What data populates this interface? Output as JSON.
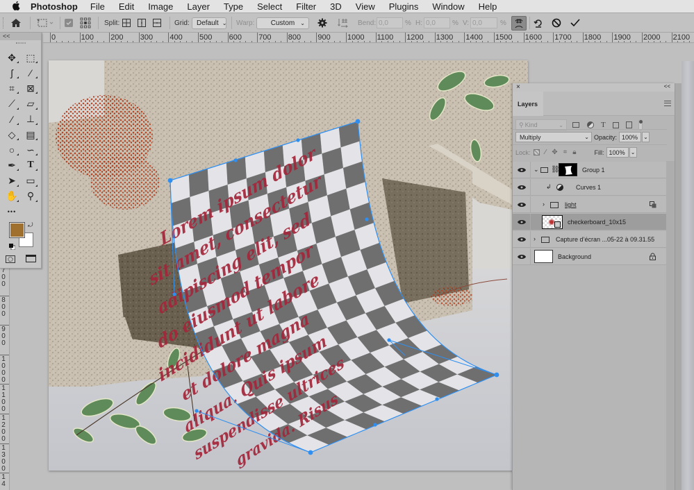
{
  "menubar": {
    "apple_icon": "apple-logo-icon",
    "items": [
      "Photoshop",
      "File",
      "Edit",
      "Image",
      "Layer",
      "Type",
      "Select",
      "Filter",
      "3D",
      "View",
      "Plugins",
      "Window",
      "Help"
    ]
  },
  "options_bar": {
    "home_icon": "home-icon",
    "transform_icon": "transform-marquee-icon",
    "checkbox_icon": "checkbox-icon",
    "reference_point_icon": "reference-point-grid-icon",
    "split_label": "Split:",
    "split_icons": [
      "split-cross-icon",
      "split-vertical-icon",
      "split-horizontal-icon"
    ],
    "grid_label": "Grid:",
    "grid_value": "Default",
    "warp_label": "Warp:",
    "warp_value": "Custom",
    "gear_icon": "gear-icon",
    "orientation_icon": "warp-orientation-icon",
    "bend_label": "Bend:",
    "bend_value": "0,0",
    "h_label": "H:",
    "h_value": "0,0",
    "v_label": "V:",
    "v_value": "0,0",
    "percent": "%",
    "warp_mode_icon": "warp-mode-icon",
    "undo_icon": "undo-icon",
    "cancel_icon": "cancel-icon",
    "commit_icon": "commit-checkmark-icon"
  },
  "rulers": {
    "horizontal": [
      "0",
      "100",
      "200",
      "300",
      "400",
      "500",
      "600",
      "700",
      "800",
      "900",
      "1000",
      "1100",
      "1200",
      "1300",
      "1400",
      "1500",
      "1600",
      "1700",
      "1800",
      "1900",
      "2000",
      "2100"
    ],
    "vertical": [
      "700",
      "800",
      "900",
      "1000",
      "1100",
      "1200",
      "1300",
      "14"
    ]
  },
  "tools": {
    "collapse": "<<",
    "items": [
      {
        "name": "move-tool",
        "glyph": "✥"
      },
      {
        "name": "rectangular-marquee-tool",
        "glyph": "⬚"
      },
      {
        "name": "lasso-tool",
        "glyph": "ʃ"
      },
      {
        "name": "magic-wand-tool",
        "glyph": "⁄"
      },
      {
        "name": "crop-tool",
        "glyph": "⌗"
      },
      {
        "name": "frame-tool",
        "glyph": "⊠"
      },
      {
        "name": "eyedropper-tool",
        "glyph": "⟋"
      },
      {
        "name": "healing-brush-tool",
        "glyph": "▱"
      },
      {
        "name": "brush-tool",
        "glyph": "∕"
      },
      {
        "name": "clone-stamp-tool",
        "glyph": "⊥"
      },
      {
        "name": "eraser-tool",
        "glyph": "◇"
      },
      {
        "name": "gradient-tool",
        "glyph": "▤"
      },
      {
        "name": "blur-tool",
        "glyph": "○"
      },
      {
        "name": "dodge-tool",
        "glyph": "∽"
      },
      {
        "name": "pen-tool",
        "glyph": "✒"
      },
      {
        "name": "type-tool",
        "glyph": "T"
      },
      {
        "name": "path-selection-tool",
        "glyph": "➤"
      },
      {
        "name": "rectangle-tool",
        "glyph": "▭"
      },
      {
        "name": "hand-tool",
        "glyph": "✋"
      },
      {
        "name": "zoom-tool",
        "glyph": "⚲"
      },
      {
        "name": "edit-toolbar",
        "glyph": "•••"
      }
    ],
    "foreground_color": "#a0712e",
    "background_color": "#ffffff",
    "swap_icon": "swap-colors-icon",
    "default_colors_icon": "default-colors-icon",
    "quick_mask_icon": "quick-mask-icon",
    "screen_mode_icon": "screen-mode-icon"
  },
  "canvas": {
    "warp_color": "#2f8ff0",
    "text_color": "#a3263a",
    "checker_dark": "#6f6f70",
    "checker_light": "#e4e4e8",
    "lorem_lines": [
      "Lorem ipsum dolor",
      "sit amet, consectetur",
      "adipiscing elit, sed",
      "do eiusmod tempor",
      "incididunt ut labore",
      "et dolore magna",
      "aliqua. Quis ipsum",
      "suspendisse ultrices",
      "gravida. Risus"
    ]
  },
  "layers_panel": {
    "close": "×",
    "collapse": "<<",
    "tab_label": "Layers",
    "menu_icon": "panel-menu-icon",
    "filter_placeholder": "Kind",
    "filter_icons": [
      "pixel-filter-icon",
      "adjustment-filter-icon",
      "type-filter-icon",
      "shape-filter-icon",
      "smart-object-filter-icon"
    ],
    "blend_mode": "Multiply",
    "opacity_label": "Opacity:",
    "opacity_value": "100%",
    "lock_label": "Lock:",
    "lock_icons": [
      "lock-transparent-icon",
      "lock-image-icon",
      "lock-position-icon",
      "lock-artboard-icon",
      "lock-all-icon"
    ],
    "fill_label": "Fill:",
    "fill_value": "100%",
    "layers": [
      {
        "name": "Group 1",
        "type": "group",
        "expanded": true,
        "selected": false
      },
      {
        "name": "Curves 1",
        "type": "adjustment",
        "selected": false
      },
      {
        "name": "light",
        "type": "group",
        "expanded": false,
        "selected": false
      },
      {
        "name": "checkerboard_10x15",
        "type": "smart-object",
        "selected": true
      },
      {
        "name": "Capture d’écran ...05-22 à 09.31.55",
        "type": "group",
        "expanded": false,
        "selected": false
      },
      {
        "name": "Background",
        "type": "background",
        "locked": true,
        "selected": false
      }
    ]
  }
}
